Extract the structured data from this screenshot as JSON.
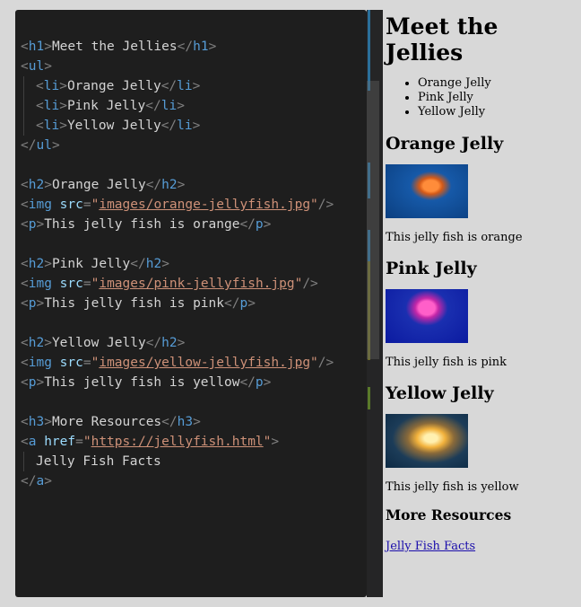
{
  "code": {
    "h1_text": "Meet the Jellies",
    "li1": "Orange Jelly",
    "li2": "Pink Jelly",
    "li3": "Yellow Jelly",
    "h2_orange": "Orange Jelly",
    "img_orange": "images/orange-jellyfish.jpg",
    "p_orange": "This jelly fish is orange",
    "h2_pink": "Pink Jelly",
    "img_pink": "images/pink-jellyfish.jpg",
    "p_pink": "This jelly fish is pink",
    "h2_yellow": "Yellow Jelly",
    "img_yellow": "images/yellow-jellyfish.jpg",
    "p_yellow": "This jelly fish is yellow",
    "h3_text": "More Resources",
    "href": "https://jellyfish.html",
    "a_text": "Jelly Fish Facts"
  },
  "preview": {
    "title": "Meet the Jellies",
    "list": [
      "Orange Jelly",
      "Pink Jelly",
      "Yellow Jelly"
    ],
    "sections": [
      {
        "heading": "Orange Jelly",
        "caption": "This jelly fish is orange"
      },
      {
        "heading": "Pink Jelly",
        "caption": "This jelly fish is pink"
      },
      {
        "heading": "Yellow Jelly",
        "caption": "This jelly fish is yellow"
      }
    ],
    "resources_heading": "More Resources",
    "link_text": "Jelly Fish Facts"
  }
}
